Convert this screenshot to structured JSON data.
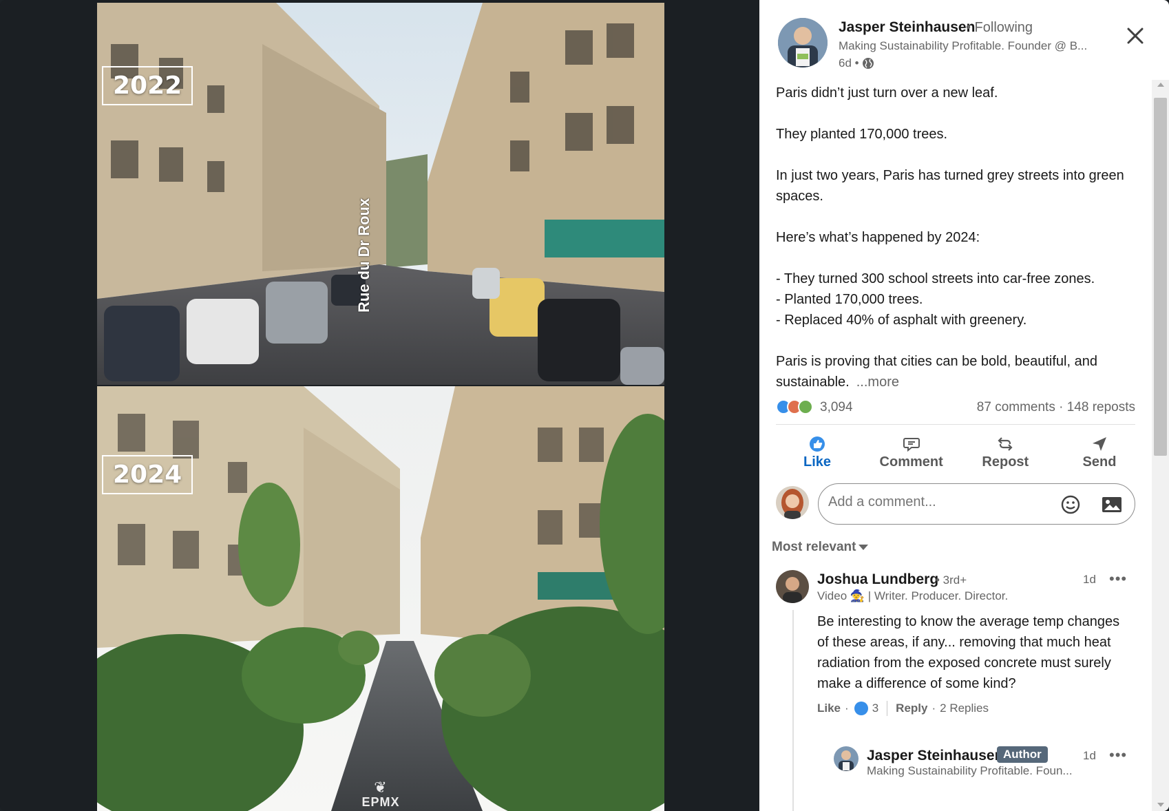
{
  "image": {
    "top_year": "2022",
    "bottom_year": "2024",
    "street_sign": "Rue du Dr Roux",
    "watermark": "EPMX"
  },
  "post": {
    "author_name": "Jasper Steinhausen",
    "following": "• Following",
    "headline": "Making Sustainability Profitable. Founder @ B...",
    "time": "6d •",
    "paragraphs": [
      "Paris didn’t just turn over a new leaf.",
      "They planted 170,000 trees.",
      "In just two years, Paris has turned grey streets into green spaces.",
      "Here’s what’s happened by 2024:"
    ],
    "bullets": [
      "- They turned 300 school streets into car-free zones.",
      "- Planted 170,000 trees.",
      "- Replaced 40% of asphalt with greenery."
    ],
    "closing": "Paris is proving that cities can be bold, beautiful, and sustainable.",
    "more": "...more",
    "reaction_count": "3,094",
    "comments_reposts": "87 comments · 148 reposts"
  },
  "actions": {
    "like": "Like",
    "comment": "Comment",
    "repost": "Repost",
    "send": "Send"
  },
  "comment_input": {
    "placeholder": "Add a comment..."
  },
  "sort": {
    "label": "Most relevant"
  },
  "comments": [
    {
      "name": "Joshua Lundberg",
      "degree": "• 3rd+",
      "headline": "Video 🧙 | Writer. Producer. Director.",
      "time": "1d",
      "body": "Be interesting to know the average temp changes of these areas, if any... removing that much heat radiation from the exposed concrete must surely make a difference of some kind?",
      "like_label": "Like",
      "like_count": "3",
      "reply_label": "Reply",
      "replies": "2 Replies",
      "reply": {
        "name": "Jasper Steinhausen",
        "badge": "Author",
        "headline": "Making Sustainability Profitable. Foun...",
        "time": "1d"
      }
    }
  ],
  "colors": {
    "brand_blue": "#0a66c2",
    "like_blue": "#378fe9",
    "dark_bg": "#1b1f23"
  }
}
